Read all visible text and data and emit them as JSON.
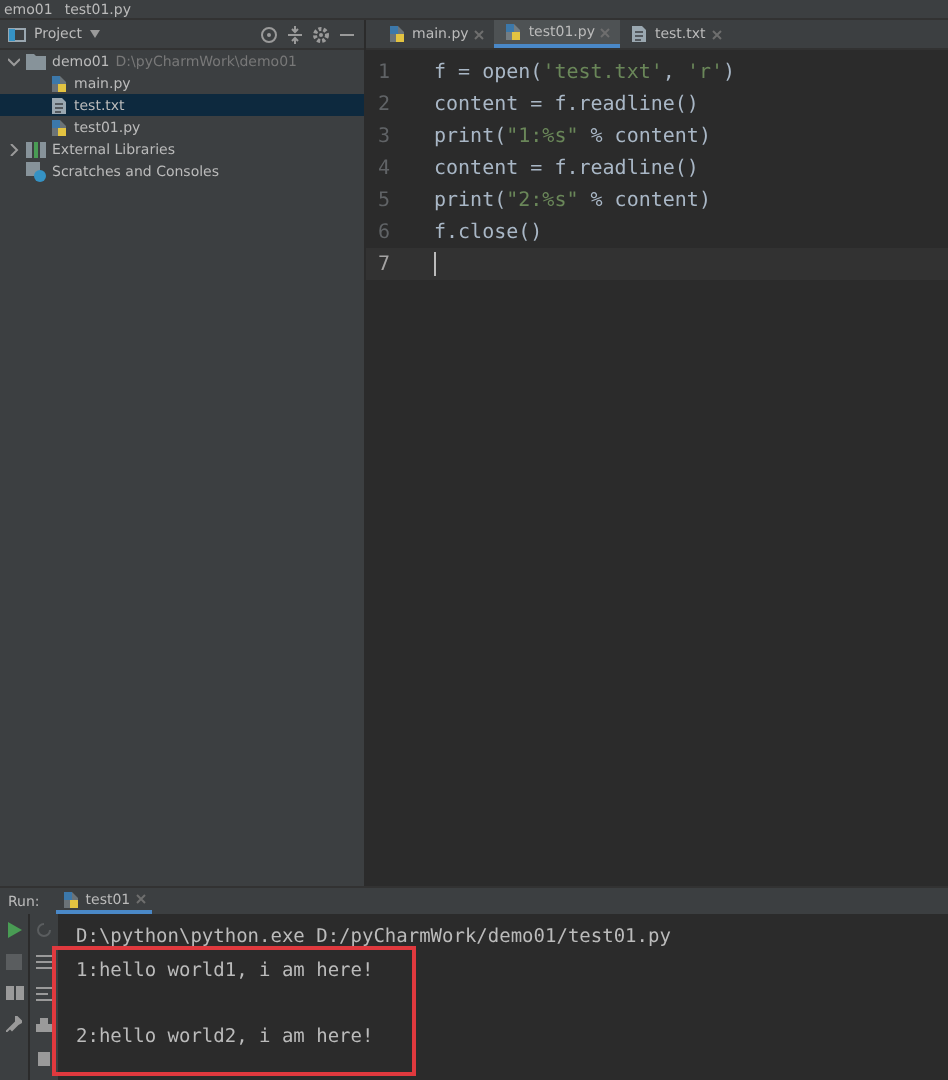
{
  "breadcrumb": [
    "emo01",
    "test01.py"
  ],
  "project_panel": {
    "title": "Project",
    "tree": [
      {
        "label": "demo01",
        "hint": "D:\\pyCharmWork\\demo01",
        "kind": "folder",
        "expanded": true,
        "selected": false,
        "children": [
          {
            "label": "main.py",
            "kind": "python",
            "selected": false
          },
          {
            "label": "test.txt",
            "kind": "text",
            "selected": true
          },
          {
            "label": "test01.py",
            "kind": "python",
            "selected": false
          }
        ]
      },
      {
        "label": "External Libraries",
        "kind": "library",
        "expanded": false,
        "selected": false
      },
      {
        "label": "Scratches and Consoles",
        "kind": "scratch",
        "selected": false
      }
    ]
  },
  "editor": {
    "tabs": [
      {
        "label": "main.py",
        "kind": "python",
        "selected": false
      },
      {
        "label": "test01.py",
        "kind": "python",
        "selected": true
      },
      {
        "label": "test.txt",
        "kind": "text",
        "selected": false
      }
    ],
    "lines": [
      {
        "number": "1",
        "current": false,
        "segments": [
          {
            "text": "f = open(",
            "kind": "plain"
          },
          {
            "text": "'test.txt'",
            "kind": "string"
          },
          {
            "text": ", ",
            "kind": "plain"
          },
          {
            "text": "'r'",
            "kind": "string"
          },
          {
            "text": ")",
            "kind": "plain"
          }
        ]
      },
      {
        "number": "2",
        "current": false,
        "segments": [
          {
            "text": "content = f.readline()",
            "kind": "plain"
          }
        ]
      },
      {
        "number": "3",
        "current": false,
        "segments": [
          {
            "text": "print(",
            "kind": "plain"
          },
          {
            "text": "\"1:%s\"",
            "kind": "string"
          },
          {
            "text": " % content)",
            "kind": "plain"
          }
        ]
      },
      {
        "number": "4",
        "current": false,
        "segments": [
          {
            "text": "content = f.readline()",
            "kind": "plain"
          }
        ]
      },
      {
        "number": "5",
        "current": false,
        "segments": [
          {
            "text": "print(",
            "kind": "plain"
          },
          {
            "text": "\"2:%s\"",
            "kind": "string"
          },
          {
            "text": " % content)",
            "kind": "plain"
          }
        ]
      },
      {
        "number": "6",
        "current": false,
        "segments": [
          {
            "text": "f.close()",
            "kind": "plain"
          }
        ]
      },
      {
        "number": "7",
        "current": true
      }
    ]
  },
  "run_panel": {
    "label": "Run:",
    "tab": "test01",
    "console_blocks": [
      [
        "D:\\python\\python.exe D:/pyCharmWork/demo01/test01.py",
        "1:hello world1, i am here!"
      ],
      [
        "2:hello world2, i am here!"
      ]
    ]
  }
}
